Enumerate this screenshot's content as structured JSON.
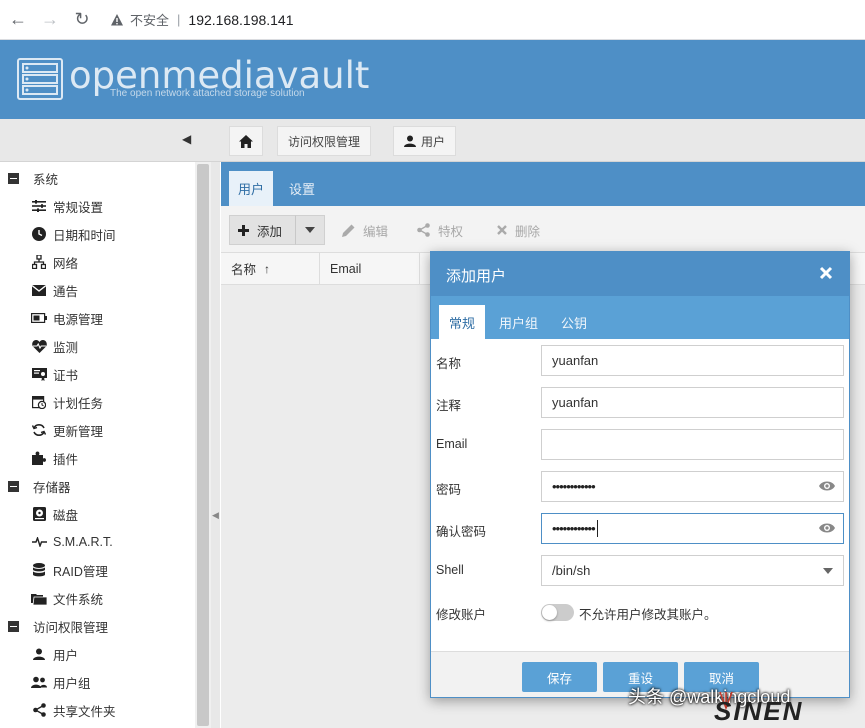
{
  "browser": {
    "security_label": "不安全",
    "separator": "|",
    "url": "192.168.198.141"
  },
  "header": {
    "brand": "openmediavault",
    "tagline": "The open network attached storage solution"
  },
  "breadcrumb": {
    "items": [
      {
        "label": "访问权限管理"
      },
      {
        "label": "用户"
      }
    ]
  },
  "sidebar": {
    "groups": [
      {
        "label": "系统",
        "items": [
          "常规设置",
          "日期和时间",
          "网络",
          "通告",
          "电源管理",
          "监测",
          "证书",
          "计划任务",
          "更新管理",
          "插件"
        ]
      },
      {
        "label": "存储器",
        "items": [
          "磁盘",
          "S.M.A.R.T.",
          "RAID管理",
          "文件系统"
        ]
      },
      {
        "label": "访问权限管理",
        "items": [
          "用户",
          "用户组",
          "共享文件夹"
        ]
      }
    ]
  },
  "main": {
    "tabs": [
      {
        "label": "用户"
      },
      {
        "label": "设置"
      }
    ],
    "toolbar": {
      "add": "添加",
      "edit": "编辑",
      "privilege": "特权",
      "delete": "删除"
    },
    "columns": [
      {
        "label": "名称"
      },
      {
        "label": "Email"
      }
    ]
  },
  "modal": {
    "title": "添加用户",
    "tabs": [
      {
        "label": "常规"
      },
      {
        "label": "用户组"
      },
      {
        "label": "公钥"
      }
    ],
    "fields": {
      "name": {
        "label": "名称",
        "value": "yuanfan"
      },
      "comment": {
        "label": "注释",
        "value": "yuanfan"
      },
      "email": {
        "label": "Email",
        "value": ""
      },
      "password": {
        "label": "密码",
        "value": "••••••••••••"
      },
      "confirm": {
        "label": "确认密码",
        "value": "••••••••••••"
      },
      "shell": {
        "label": "Shell",
        "value": "/bin/sh"
      },
      "modify": {
        "label": "修改账户",
        "toggle_text": "不允许用户修改其账户。",
        "enabled": false
      }
    },
    "buttons": {
      "save": "保存",
      "reset": "重设",
      "cancel": "取消"
    }
  },
  "watermark": {
    "text": "头条 @walkingcloud",
    "logo_text": "SINEN"
  },
  "colors": {
    "header_blue": "#4e8fc6",
    "tab_blue": "#5aa1d6",
    "button_blue": "#5aa1d6"
  }
}
